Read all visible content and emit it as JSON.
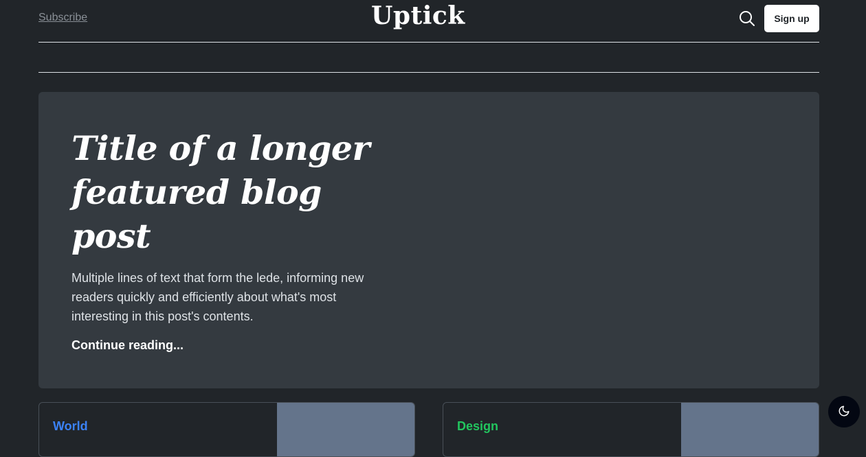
{
  "header": {
    "subscribe_label": "Subscribe",
    "brand": "Uptick",
    "search_icon": "search-icon",
    "signup_label": "Sign up"
  },
  "featured": {
    "title": "Title of a longer featured blog post",
    "lede": "Multiple lines of text that form the lede, informing new readers quickly and efficiently about what's most interesting in this post's contents.",
    "link_label": "Continue reading..."
  },
  "posts": [
    {
      "category": "World",
      "category_color": "#3b82f6"
    },
    {
      "category": "Design",
      "category_color": "#22c55e"
    }
  ],
  "theme_toggle": {
    "icon": "moon-icon"
  },
  "colors": {
    "background": "#212529",
    "hero_bg": "#343a40",
    "thumb_bg": "#64748b",
    "button_bg": "#ffffff"
  }
}
